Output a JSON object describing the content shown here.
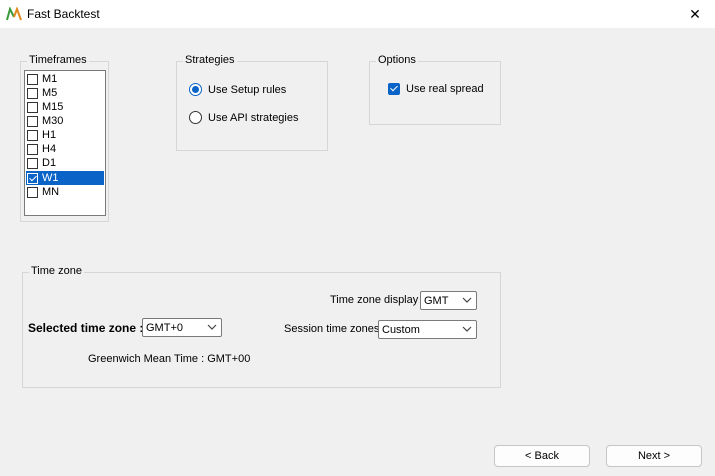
{
  "window": {
    "title": "Fast Backtest",
    "close_glyph": "✕"
  },
  "timeframes": {
    "label": "Timeframes",
    "items": [
      {
        "label": "M1",
        "checked": false
      },
      {
        "label": "M5",
        "checked": false
      },
      {
        "label": "M15",
        "checked": false
      },
      {
        "label": "M30",
        "checked": false
      },
      {
        "label": "H1",
        "checked": false
      },
      {
        "label": "H4",
        "checked": false
      },
      {
        "label": "D1",
        "checked": false
      },
      {
        "label": "W1",
        "checked": true
      },
      {
        "label": "MN",
        "checked": false
      }
    ]
  },
  "strategies": {
    "label": "Strategies",
    "options": [
      {
        "label": "Use Setup rules",
        "selected": true
      },
      {
        "label": "Use API strategies",
        "selected": false
      }
    ]
  },
  "options": {
    "label": "Options",
    "real_spread": {
      "label": "Use real spread",
      "checked": true
    }
  },
  "timezone": {
    "label": "Time zone",
    "display_label": "Time zone display :",
    "display_value": "GMT",
    "selected_label": "Selected time zone :",
    "selected_value": "GMT+0",
    "session_label": "Session time zones :",
    "session_value": "Custom",
    "gmt_info": "Greenwich Mean Time : GMT+00"
  },
  "buttons": {
    "back": "< Back",
    "next": "Next >"
  },
  "colors": {
    "accent": "#0a64c8",
    "logo_green": "#3a9a3a",
    "logo_orange": "#e08a1e"
  }
}
